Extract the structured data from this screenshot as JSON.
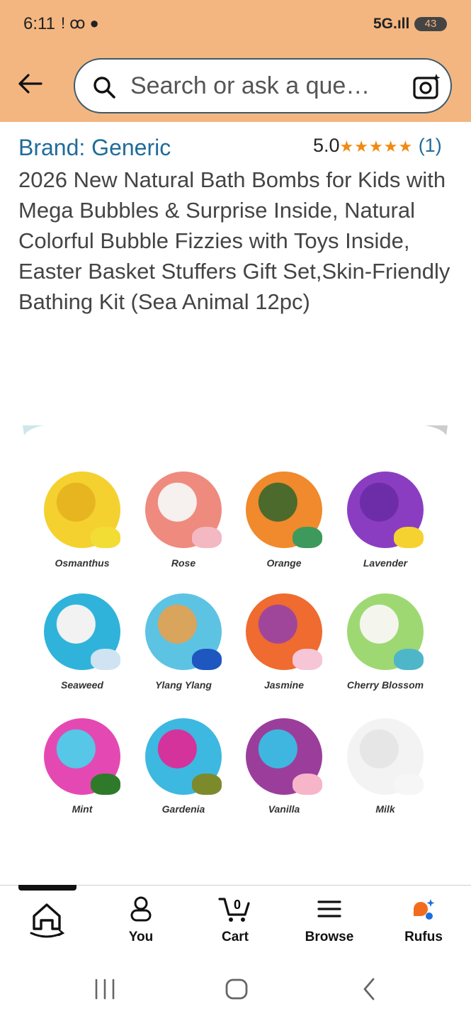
{
  "status": {
    "time": "6:11",
    "network": "5G",
    "battery": "43"
  },
  "search": {
    "placeholder": "Search or ask a que…"
  },
  "product": {
    "brand": "Brand: Generic",
    "rating": "5.0",
    "stars": "★★★★★",
    "rating_count": "(1)",
    "title": "2026 New Natural Bath Bombs for Kids with Mega Bubbles & Surprise Inside, Natural Colorful Bubble Fizzies with Toys Inside, Easter Basket Stuffers Gift Set,Skin-Friendly Bathing Kit (Sea Animal 12pc)"
  },
  "image": {
    "balls": [
      {
        "label": "Osmanthus",
        "color": "#f5d130",
        "inner": "#e6b520",
        "toy": "#f2dd35"
      },
      {
        "label": "Rose",
        "color": "#ee8a7e",
        "inner": "#f6f0ee",
        "toy": "#f3b8c1"
      },
      {
        "label": "Orange",
        "color": "#f08a2c",
        "inner": "#4b6a2c",
        "toy": "#3d9a5c"
      },
      {
        "label": "Lavender",
        "color": "#8b3dc2",
        "inner": "#6e2da8",
        "toy": "#f5d230"
      },
      {
        "label": "Seaweed",
        "color": "#2fb3da",
        "inner": "#f2f2f2",
        "toy": "#cfe3f3"
      },
      {
        "label": "Ylang Ylang",
        "color": "#5dc3e3",
        "inner": "#d9a45c",
        "toy": "#1e57c0"
      },
      {
        "label": "Jasmine",
        "color": "#ef6b2f",
        "inner": "#a0469a",
        "toy": "#f6c5d6"
      },
      {
        "label": "Cherry Blossom",
        "color": "#9ed872",
        "inner": "#f4f6ee",
        "toy": "#4fb6c9"
      },
      {
        "label": "Mint",
        "color": "#e449b3",
        "inner": "#56c7e6",
        "toy": "#2f7a2a"
      },
      {
        "label": "Gardenia",
        "color": "#3db8e0",
        "inner": "#d4339c",
        "toy": "#7c8a2c"
      },
      {
        "label": "Vanilla",
        "color": "#9b3e9b",
        "inner": "#3fb6e0",
        "toy": "#f6b5c9"
      },
      {
        "label": "Milk",
        "color": "#f3f3f3",
        "inner": "#e6e6e6",
        "toy": "#f6f6f6"
      }
    ]
  },
  "nav": {
    "items": [
      {
        "label": "",
        "icon": "home-icon"
      },
      {
        "label": "You",
        "icon": "person-icon"
      },
      {
        "label": "Cart",
        "icon": "cart-icon",
        "badge": "0"
      },
      {
        "label": "Browse",
        "icon": "menu-icon"
      },
      {
        "label": "Rufus",
        "icon": "rufus-icon"
      }
    ]
  }
}
